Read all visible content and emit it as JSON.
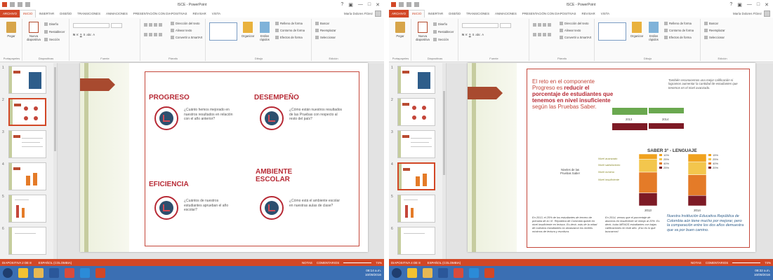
{
  "colors": {
    "accent": "#d24726",
    "slide_red": "#b72a35",
    "taskbar": "#3b6fb3"
  },
  "left": {
    "doc_title": "ISCE - PowerPoint",
    "window_controls": [
      "?",
      "▣",
      "—",
      "□",
      "✕"
    ],
    "tabs": [
      "ARCHIVO",
      "INICIO",
      "INSERTAR",
      "DISEÑO",
      "TRANSICIONES",
      "ANIMACIONES",
      "PRESENTACIÓN CON DIAPOSITIVAS",
      "REVISAR",
      "VISTA"
    ],
    "user": "María Dolores Flórez",
    "ribbon": {
      "paste": "Pegar",
      "new_slide": "Nueva diapositiva",
      "layout": "Diseño",
      "reset": "Restablecer",
      "section": "Sección",
      "text_dir": "Dirección del texto",
      "align_text": "Alinear texto",
      "smartart": "Convertir a SmartArt",
      "arrange": "Organizar",
      "quick_styles": "Estilos rápidos",
      "fill": "Relleno de forma",
      "outline": "Contorno de forma",
      "effects": "Efectos de forma",
      "find": "Buscar",
      "replace": "Reemplazar",
      "select": "Seleccionar",
      "groups": [
        "Portapapeles",
        "Diapositivas",
        "Fuente",
        "Párrafo",
        "Dibujo",
        "Edición"
      ]
    },
    "slide_numbers": [
      "1",
      "2",
      "3",
      "4",
      "5",
      "6"
    ],
    "slide": {
      "progreso": "PROGRESO",
      "progreso_q": "¿Cuánto hemos mejorado en nuestros resultados en relación con el año anterior?",
      "desempeno": "DESEMPEÑO",
      "desempeno_q": "¿Cómo están nuestros resultados de las Pruebas con respecto al resto del país?",
      "eficiencia": "EFICIENCIA",
      "eficiencia_q": "¿Cuántos de nuestros estudiantes aprueban el año escolar?",
      "ambiente": "AMBIENTE ESCOLAR",
      "ambiente_q": "¿Cómo está el ambiente escolar en nuestras aulas de clase?"
    },
    "status": {
      "slide_info": "DIAPOSITIVA 2 DE 8",
      "lang": "ESPAÑOL (COLOMBIA)",
      "notes": "NOTAS",
      "comments": "COMENTARIOS",
      "zoom": "74%"
    },
    "clock": {
      "time": "08:14 a.m.",
      "date": "10/09/2016"
    }
  },
  "right": {
    "doc_title": "ISCE - PowerPoint",
    "user": "María Dolores Flórez",
    "slide_numbers": [
      "1",
      "2",
      "3",
      "4",
      "5",
      "6"
    ],
    "slide": {
      "title_part1": "El reto en el componente Progreso es ",
      "title_bold": "reducir el porcentaje de estudiantes que tenemos en nivel insuficiente",
      "title_part2": " según las Pruebas Saber.",
      "side_note": "También reconocemos una mejor calificación si logramos aumentar la cantidad de estudiantes que tenemos en el nivel avanzado.",
      "year_2013": "2013",
      "year_2014": "2014",
      "chart_title": "SABER 3° - LENGUAJE",
      "niveles_label": "Niveles de las Pruebas Saber",
      "levels": [
        "Nivel avanzado",
        "Nivel satisfactorio",
        "Nivel mínimo",
        "Nivel insuficiente"
      ],
      "foot_1": "En 2013, el 25% de los estudiantes de tercero de primaria de la I.E. República de Colombia quedó en nivel insuficiente en lectura. Es decir, más de la mitad de nuestros estudiantes no alcanzaron los niveles mínimos de lectura y escritura.",
      "foot_2": "En 2014, vemos que el porcentaje de alumnos en insuficiente se redujo al 20%. Es decir, hubo MENOS estudiantes con bajas calificaciones en este año. ¡Eso es lo que buscamos!",
      "foot_3": "Nuestra Institución Educativa República de Colombia aún tiene mucho por mejorar, pero la comparación entre los dos años demuestra que va por buen camino."
    },
    "status": {
      "slide_info": "DIAPOSITIVA 4 DE 8",
      "lang": "ESPAÑOL (COLOMBIA)",
      "notes": "NOTAS",
      "comments": "COMENTARIOS",
      "zoom": "74%"
    },
    "clock": {
      "time": "08:32 a.m.",
      "date": "10/09/2016"
    }
  },
  "chart_data": {
    "type": "bar",
    "title": "SABER 3° - LENGUAJE",
    "categories": [
      "2013",
      "2014"
    ],
    "series": [
      {
        "name": "Nivel avanzado",
        "values": [
          10,
          15
        ]
      },
      {
        "name": "Nivel satisfactorio",
        "values": [
          25,
          25
        ]
      },
      {
        "name": "Nivel mínimo",
        "values": [
          40,
          40
        ]
      },
      {
        "name": "Nivel insuficiente",
        "values": [
          25,
          20
        ]
      }
    ],
    "labels_2013": [
      "10%",
      "25%",
      "40%",
      "25%"
    ],
    "labels_2014": [
      "15%",
      "25%",
      "40%",
      "20%"
    ],
    "segment_colors": [
      "#f0a21e",
      "#f3c64d",
      "#e47b28",
      "#7d1a25"
    ]
  }
}
